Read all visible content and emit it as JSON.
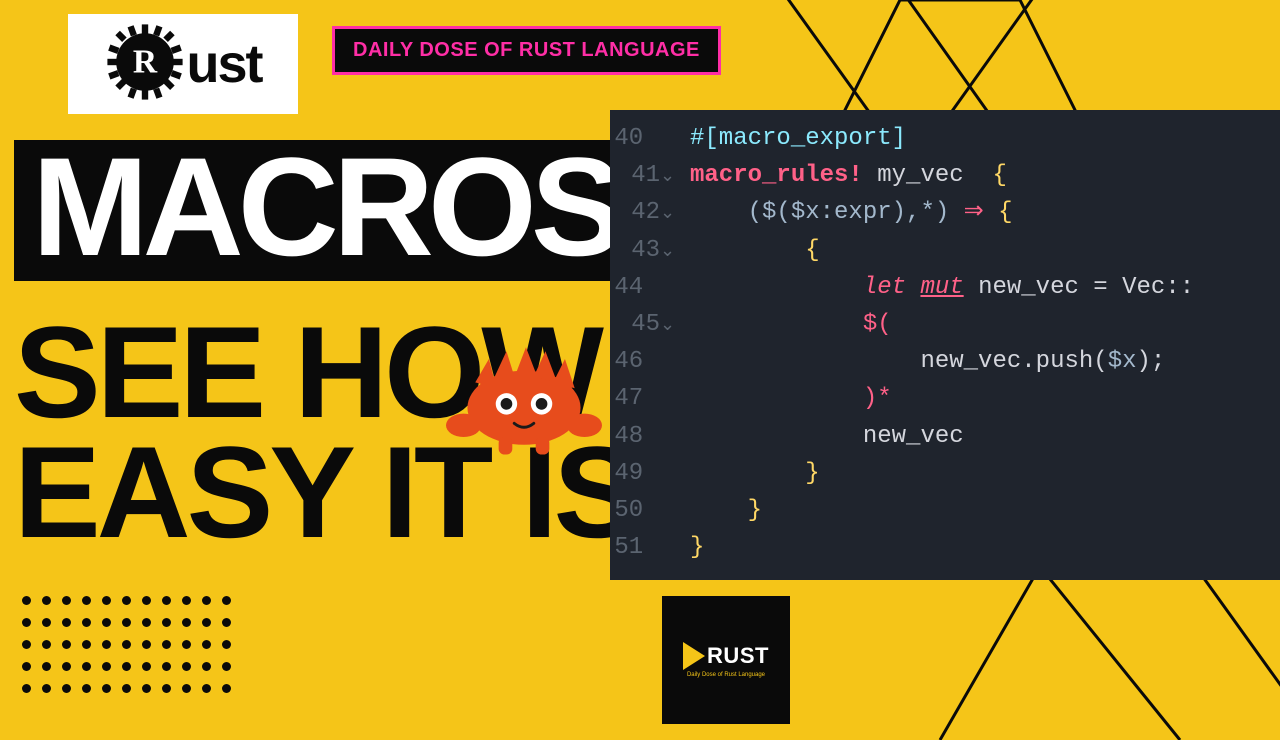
{
  "logo": {
    "text": "ust"
  },
  "banner": "DAILY DOSE OF RUST LANGUAGE",
  "headline": {
    "line1": "MACROS",
    "line2": "SEE HOW",
    "line3": "EASY IT IS"
  },
  "brand": {
    "text": "RUST",
    "sub": "Daily Dose of Rust Language"
  },
  "code": {
    "line_numbers": [
      "40",
      "41",
      "42",
      "43",
      "44",
      "45",
      "46",
      "47",
      "48",
      "49",
      "50",
      "51"
    ],
    "lines": {
      "l40_attr": "#[macro_export]",
      "l41_macro": "macro_rules!",
      "l41_name": " my_vec  ",
      "l41_brace": "{",
      "l42_meta_open": "(",
      "l42_meta_body": "$($x:expr),*",
      "l42_meta_close": ")",
      "l42_arrow": " ⇒ ",
      "l42_brace": "{",
      "l43_brace": "{",
      "l44_let": "let",
      "l44_mut": "mut",
      "l44_var": " new_vec ",
      "l44_eq": "= ",
      "l44_type": "Vec",
      "l44_cc": "::",
      "l45_open": "$(",
      "l46_call": "new_vec",
      "l46_punc": ".push(",
      "l46_arg": "$x",
      "l46_end": ");",
      "l47_close": ")*",
      "l48_var": "new_vec",
      "l49_brace": "}",
      "l50_brace": "}",
      "l51_brace": "}"
    }
  }
}
